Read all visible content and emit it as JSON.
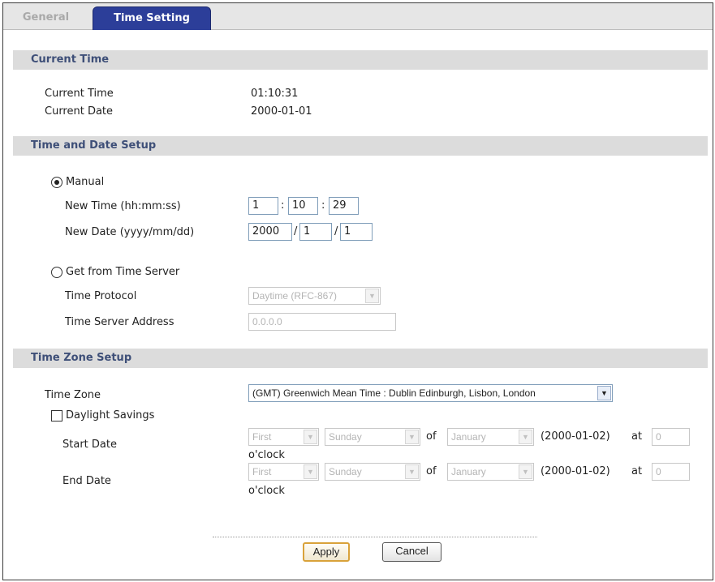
{
  "tabs": {
    "general": "General",
    "time_setting": "Time Setting"
  },
  "current_time_section": {
    "title": "Current Time",
    "time_label": "Current Time",
    "time_value": "01:10:31",
    "date_label": "Current Date",
    "date_value": "2000-01-01"
  },
  "time_date_setup": {
    "title": "Time and Date Setup",
    "manual_label": "Manual",
    "manual_selected": true,
    "new_time_label": "New Time (hh:mm:ss)",
    "new_time": {
      "hh": "1",
      "mm": "10",
      "ss": "29",
      "sep": ":"
    },
    "new_date_label": "New Date (yyyy/mm/dd)",
    "new_date": {
      "yyyy": "2000",
      "mm": "1",
      "dd": "1",
      "sep": "/"
    },
    "server_label": "Get from Time Server",
    "server_selected": false,
    "protocol_label": "Time Protocol",
    "protocol_value": "Daytime (RFC-867)",
    "server_address_label": "Time Server Address",
    "server_address_value": "0.0.0.0"
  },
  "time_zone_setup": {
    "title": "Time Zone Setup",
    "zone_label": "Time Zone",
    "zone_value": "(GMT) Greenwich Mean Time : Dublin Edinburgh, Lisbon, London",
    "daylight_label": "Daylight Savings",
    "daylight_checked": false,
    "start": {
      "label": "Start Date",
      "week": "First",
      "day": "Sunday",
      "of": "of",
      "month": "January",
      "date_text": "(2000-01-02)",
      "at": "at",
      "hour": "0",
      "oclock": "o'clock"
    },
    "end": {
      "label": "End Date",
      "week": "First",
      "day": "Sunday",
      "of": "of",
      "month": "January",
      "date_text": "(2000-01-02)",
      "at": "at",
      "hour": "0",
      "oclock": "o'clock"
    }
  },
  "buttons": {
    "apply": "Apply",
    "cancel": "Cancel"
  },
  "icons": {
    "select_arrow": "chevron-down-icon"
  },
  "colors": {
    "tab_active": "#2c3e99",
    "section_title": "#3e4f78",
    "section_bg": "#dcdcdc",
    "apply_border": "#d9a23a"
  }
}
